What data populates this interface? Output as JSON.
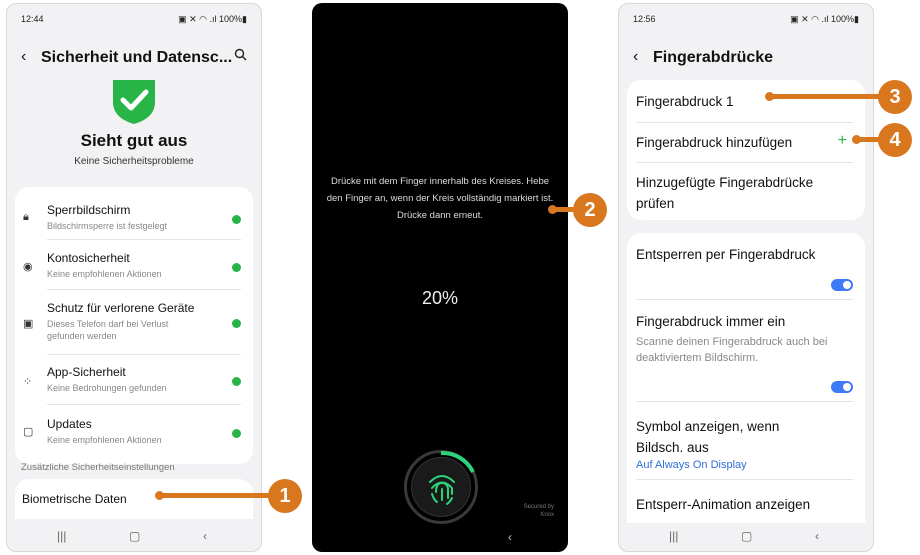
{
  "screen1": {
    "time": "12:44",
    "battery": "100%",
    "title": "Sicherheit und Datensc...",
    "status_title": "Sieht gut aus",
    "status_sub": "Keine Sicherheitsprobleme",
    "items": [
      {
        "title": "Sperrbildschirm",
        "sub": "Bildschirmsperre ist festgelegt"
      },
      {
        "title": "Kontosicherheit",
        "sub": "Keine empfohlenen Aktionen"
      },
      {
        "title": "Schutz für verlorene Geräte",
        "sub": "Dieses Telefon darf bei Verlust gefunden werden"
      },
      {
        "title": "App-Sicherheit",
        "sub": "Keine Bedrohungen gefunden"
      },
      {
        "title": "Updates",
        "sub": "Keine empfohlenen Aktionen"
      }
    ],
    "section_label": "Zusätzliche Sicherheitseinstellungen",
    "biometric": "Biometrische Daten",
    "status_color": "#28b446"
  },
  "screen2": {
    "instruction": "Drücke mit dem Finger innerhalb des Kreises. Hebe den Finger an, wenn der Kreis vollständig markiert ist. Drücke dann erneut.",
    "progress": "20%",
    "progress_value": 0.2,
    "secured_by": "Secured by",
    "knox": "Knox"
  },
  "screen3": {
    "time": "12:56",
    "battery": "100%",
    "title": "Fingerabdrücke",
    "fp1": "Fingerabdruck 1",
    "add": "Fingerabdruck hinzufügen",
    "check": "Hinzugefügte Fingerabdrücke prüfen",
    "unlock": "Entsperren per Fingerabdruck",
    "always_on": "Fingerabdruck immer ein",
    "always_on_sub": "Scanne deinen Fingerabdruck auch bei deaktiviertem Bildschirm.",
    "symbol": "Symbol anzeigen, wenn Bildsch. aus",
    "aod_link": "Auf Always On Display",
    "anim": "Entsperr-Animation anzeigen",
    "accent": "#3e7bf4",
    "link_color": "#2f6fd8"
  },
  "callouts": [
    "1",
    "2",
    "3",
    "4"
  ],
  "callout_color": "#d9771e"
}
